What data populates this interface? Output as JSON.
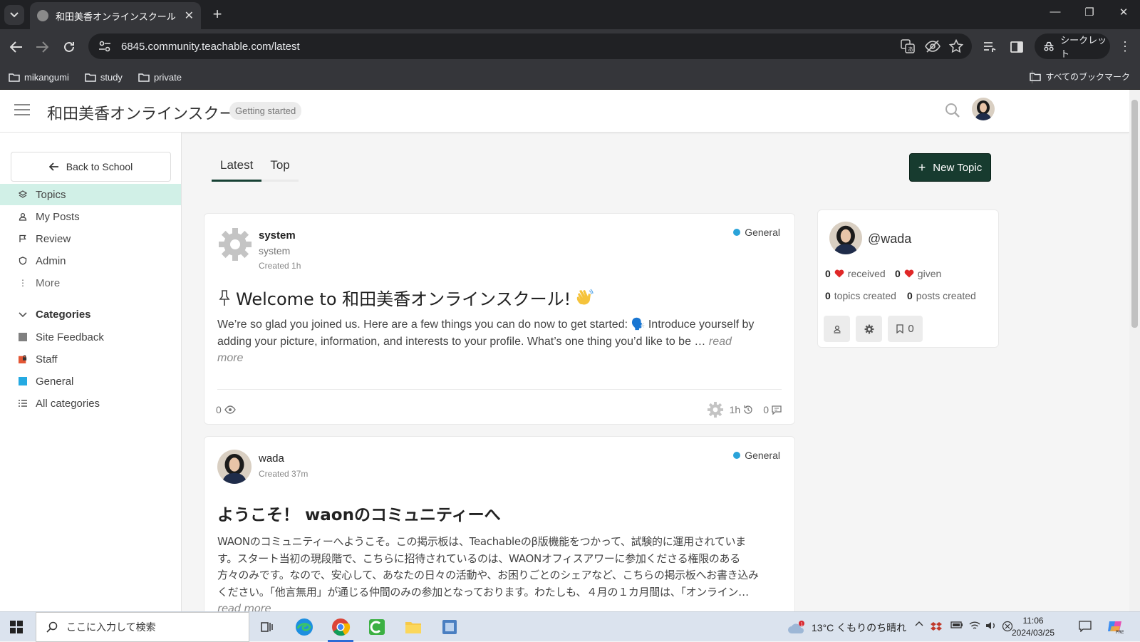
{
  "browser": {
    "tab_title": "和田美香オンラインスクール",
    "url": "6845.community.teachable.com/latest",
    "incognito_label": "シークレット",
    "bookmarks": [
      "mikangumi",
      "study",
      "private"
    ],
    "all_bookmarks_label": "すべてのブックマーク"
  },
  "header": {
    "site_title": "和田美香オンラインスクール",
    "getting_started": "Getting started"
  },
  "sidebar": {
    "back_label": "Back to School",
    "nav": [
      {
        "label": "Topics",
        "icon": "layers-icon"
      },
      {
        "label": "My Posts",
        "icon": "user-icon"
      },
      {
        "label": "Review",
        "icon": "flag-icon"
      },
      {
        "label": "Admin",
        "icon": "shield-icon"
      },
      {
        "label": "More",
        "icon": "dots-vertical-icon"
      }
    ],
    "categories_heading": "Categories",
    "categories": [
      {
        "label": "Site Feedback",
        "color": "#808080"
      },
      {
        "label": "Staff",
        "color": "#e45735"
      },
      {
        "label": "General",
        "color": "#25aae2"
      },
      {
        "label": "All categories",
        "icon": "list-icon"
      }
    ]
  },
  "main": {
    "tabs": [
      "Latest",
      "Top"
    ],
    "new_topic": "New Topic",
    "posts": [
      {
        "author": "system",
        "username": "system",
        "created": "Created 1h",
        "category": "General",
        "title": "Welcome to 和田美香オンラインスクール!",
        "excerpt": "We’re so glad you joined us. Here are a few things you can do now to get started: 🗣️ Introduce yourself by adding your picture, information, and interests to your profile. What’s one thing you’d like to be …",
        "read_more": "read more",
        "views": "0",
        "activity": "1h",
        "replies": "0"
      },
      {
        "author": "wada",
        "created": "Created 37m",
        "category": "General",
        "title": "ようこそ！ waonのコミュニティーへ",
        "excerpt": "WAONのコミュニティーへようこそ。この掲示板は、Teachableのβ版機能をつかって、試験的に運用されています。スタート当初の現段階で、こちらに招待されているのは、WAONオフィスアワーに参加くださる権限のある方々のみです。なので、安心して、あなたの日々の活動や、お困りごとのシェアなど、こちらの掲示板へお書き込みください。「他言無用」が通じる仲間のみの参加となっております。わたしも、４月の１カ月間は、「オンライン…",
        "read_more": "read more"
      }
    ]
  },
  "profile": {
    "handle": "@wada",
    "likes_received": "0",
    "received_label": "received",
    "likes_given": "0",
    "given_label": "given",
    "topics_created": "0",
    "topics_label": "topics created",
    "posts_created": "0",
    "posts_label": "posts created",
    "bookmarks_count": "0"
  },
  "taskbar": {
    "search_placeholder": "ここに入力して検索",
    "weather": "13°C くもりのち晴れ",
    "time": "11:06",
    "date": "2024/03/25"
  }
}
